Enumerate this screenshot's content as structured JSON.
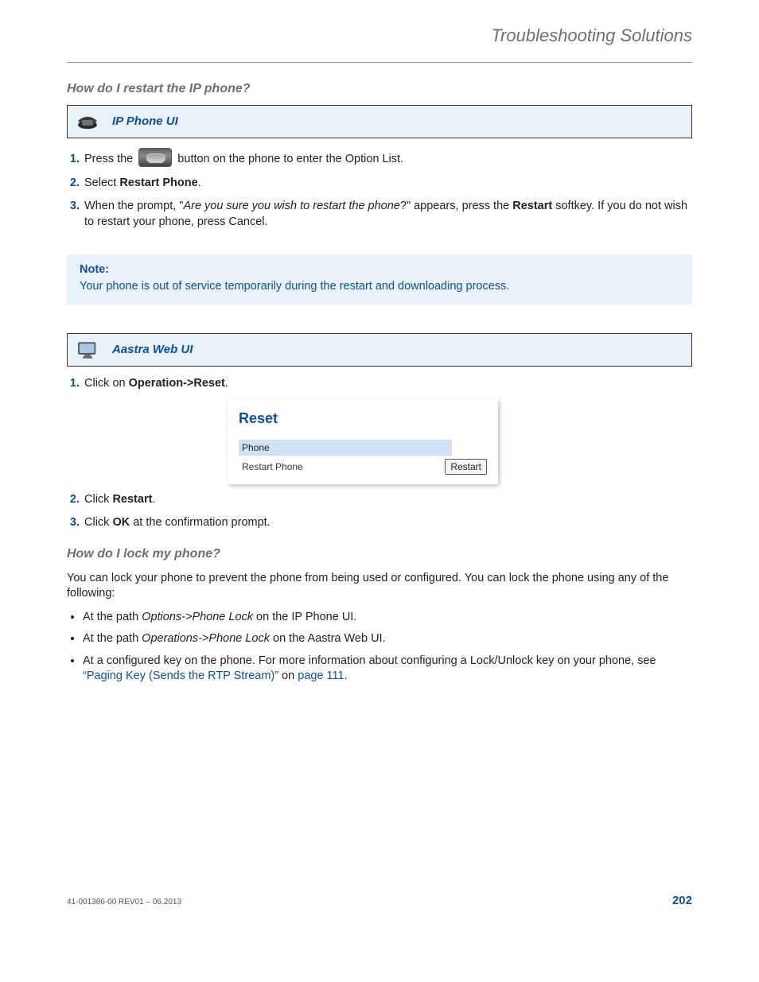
{
  "header": {
    "title": "Troubleshooting Solutions"
  },
  "q1": {
    "heading": "How do I restart the IP phone?",
    "bar1_label": "IP Phone UI",
    "s1_pre": "Press the ",
    "s1_post": " button on the phone to enter the Option List.",
    "s2_pre": "Select ",
    "s2_bold": "Restart Phone",
    "s2_post": ".",
    "s3_a": "When the prompt, \"",
    "s3_b": "Are you sure you wish to restart the phone",
    "s3_c": "?\" appears, press the ",
    "s3_d": "Restart",
    "s3_e": " softkey. If you do not wish to restart your phone, press Cancel.",
    "note_label": "Note:",
    "note_text": "Your phone is out of service temporarily during the restart and downloading process.",
    "bar2_label": "Aastra Web UI",
    "w1_pre": "Click on ",
    "w1_bold": "Operation->Reset",
    "w1_post": ".",
    "reset_title": "Reset",
    "reset_phone": "Phone",
    "reset_restart_label": "Restart Phone",
    "reset_button": "Restart",
    "w2_pre": "Click ",
    "w2_bold": "Restart",
    "w2_post": ".",
    "w3_pre": "Click ",
    "w3_bold": "OK",
    "w3_post": " at the confirmation prompt."
  },
  "q2": {
    "heading": "How do I lock my phone?",
    "intro": "You can lock your phone to prevent the phone from being used or configured. You can lock the phone using any of the following:",
    "b1_a": "At the path ",
    "b1_b": "Options->Phone Lock",
    "b1_c": " on the IP Phone UI.",
    "b2_a": "At the path ",
    "b2_b": "Operations->Phone Lock",
    "b2_c": " on the Aastra Web UI.",
    "b3_a": "At a configured key on the phone. For more information about configuring a Lock/Unlock key on your phone, see ",
    "b3_link1": "“Paging Key (Sends the RTP Stream)”",
    "b3_b": " on ",
    "b3_link2": "page 111",
    "b3_c": "."
  },
  "footer": {
    "rev": "41-001386-00 REV01 – 06.2013",
    "page": "202"
  }
}
